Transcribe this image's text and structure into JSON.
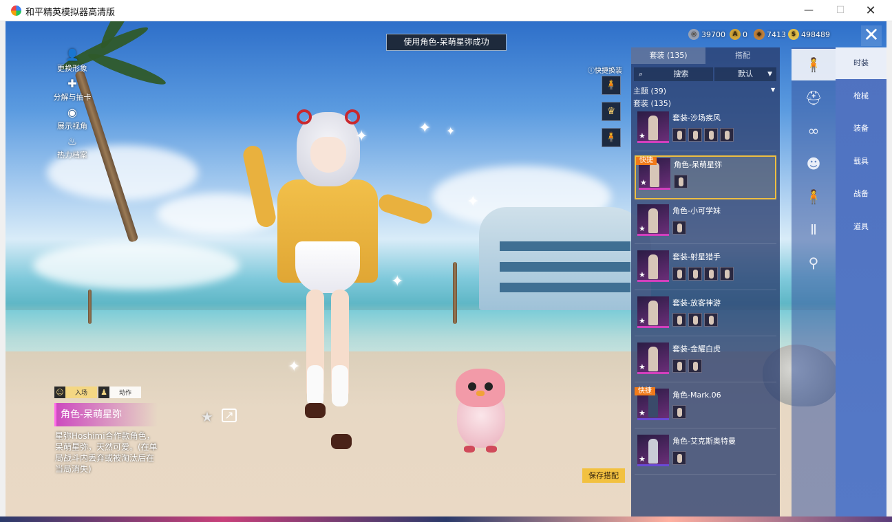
{
  "window": {
    "title": "和平精英模拟器高清版",
    "minimize": "—",
    "maximize": "☐",
    "close": "✕"
  },
  "toast": "使用角色-呆萌星弥成功",
  "currency": [
    {
      "value": "39700",
      "color": "#9aa3b5"
    },
    {
      "value": "0",
      "color": "#d4a73a"
    },
    {
      "value": "7413",
      "color": "#c0803a"
    },
    {
      "value": "498489",
      "color": "#e6c24a"
    }
  ],
  "close_button": "✕",
  "left_menu": [
    {
      "label": "更换形象",
      "icon": "person-icon"
    },
    {
      "label": "分解与抽卡",
      "icon": "puzzle-icon"
    },
    {
      "label": "展示视角",
      "icon": "eye-icon"
    },
    {
      "label": "热力档案",
      "icon": "flame-icon"
    }
  ],
  "quick_swap": {
    "label": "快捷换装"
  },
  "panel": {
    "tabs": [
      "套装 (135)",
      "搭配"
    ],
    "search": "搜索",
    "sort": "默认",
    "group_theme": "主题 (39)",
    "group_outfit": "套装 (135)",
    "items": [
      {
        "name": "套装-沙场疾风",
        "quick": "",
        "subs": 4
      },
      {
        "name": "角色-呆萌星弥",
        "quick": "快捷",
        "subs": 1,
        "selected": true
      },
      {
        "name": "角色-小可学妹",
        "quick": "",
        "subs": 1
      },
      {
        "name": "套装-射星猎手",
        "quick": "",
        "subs": 4
      },
      {
        "name": "套装-放客神游",
        "quick": "",
        "subs": 3
      },
      {
        "name": "套装-金耀白虎",
        "quick": "",
        "subs": 2
      },
      {
        "name": "角色-Mark.06",
        "quick": "快捷",
        "subs": 1
      },
      {
        "name": "角色-艾克斯奥特曼",
        "quick": "",
        "subs": 1
      }
    ]
  },
  "categories": [
    {
      "label": "时装",
      "icon": "outfit-icon",
      "active": true
    },
    {
      "label": "枪械",
      "icon": "helmet-icon"
    },
    {
      "label": "装备",
      "icon": "goggles-icon"
    },
    {
      "label": "载具",
      "icon": "head-icon"
    },
    {
      "label": "战备",
      "icon": "figure-icon"
    },
    {
      "label": "道具",
      "icon": "pants-icon"
    },
    {
      "label": "",
      "icon": "shoes-icon"
    }
  ],
  "action_tabs": [
    "入场",
    "动作"
  ],
  "outfit": {
    "name": "角色-呆萌星弥",
    "description": "星弥Hoshimi合作款角色，呆萌星弥，天然可爱。(在单局战斗内丢弃或被淘汰后在当局消失)"
  },
  "save_button": "保存搭配"
}
